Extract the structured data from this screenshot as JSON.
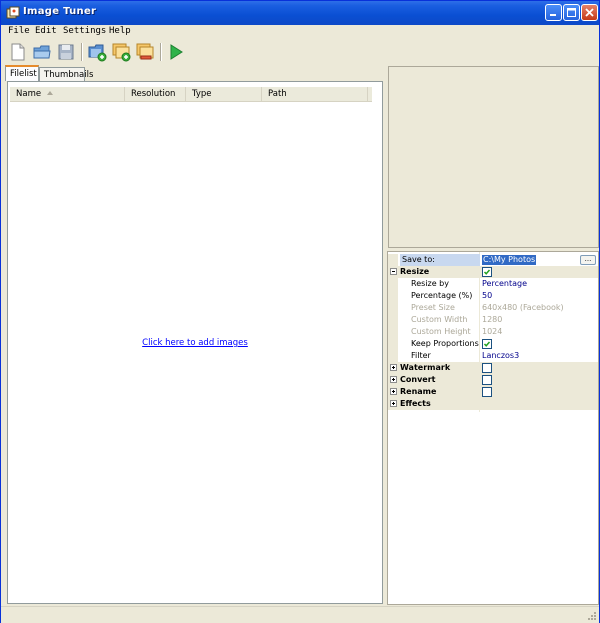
{
  "window": {
    "title": "Image Tuner"
  },
  "menu": {
    "items": [
      "File",
      "Edit",
      "Settings",
      "Help"
    ]
  },
  "tabs": [
    "Filelist",
    "Thumbnails"
  ],
  "filelist": {
    "columns": [
      "Name",
      "Resolution",
      "Type",
      "Path"
    ],
    "empty_link": "Click here to add images"
  },
  "properties": {
    "save_to": {
      "label": "Save to:",
      "value": "C:\\My Photos",
      "browse": "..."
    },
    "resize": {
      "label": "Resize",
      "checked": true
    },
    "resize_by": {
      "label": "Resize by",
      "value": "Percentage"
    },
    "percentage": {
      "label": "Percentage (%)",
      "value": "50"
    },
    "preset_size": {
      "label": "Preset Size",
      "value": "640x480 (Facebook)"
    },
    "custom_width": {
      "label": "Custom Width",
      "value": "1280"
    },
    "custom_height": {
      "label": "Custom Height",
      "value": "1024"
    },
    "keep_proportions": {
      "label": "Keep Proportions",
      "checked": true
    },
    "filter": {
      "label": "Filter",
      "value": "Lanczos3"
    },
    "watermark": {
      "label": "Watermark",
      "checked": false
    },
    "convert": {
      "label": "Convert",
      "checked": false
    },
    "rename": {
      "label": "Rename",
      "checked": false
    },
    "effects": {
      "label": "Effects"
    }
  },
  "icons": [
    "new-file-icon",
    "open-folder-icon",
    "save-icon",
    "add-folder-icon",
    "add-images-icon",
    "remove-images-icon",
    "run-icon"
  ],
  "colors": {
    "titlebar": "#0a4fd3",
    "link": "#0000ff",
    "selection": "#316ac5",
    "tab_accent": "#e68b2c",
    "run": "#2fb34a"
  }
}
